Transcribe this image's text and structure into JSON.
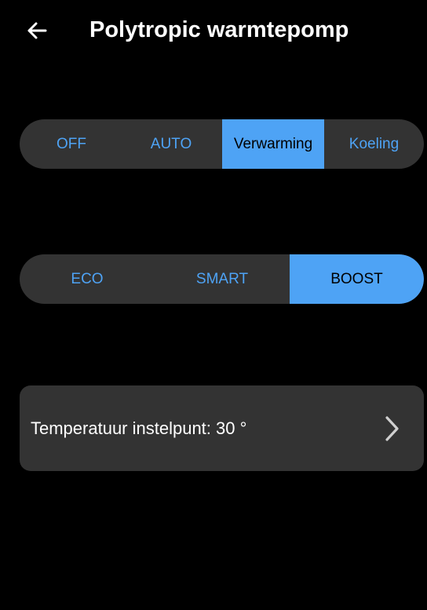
{
  "header": {
    "back_icon": "arrow-left-icon",
    "title": "Polytropic warmtepomp"
  },
  "mode_selector": {
    "options": [
      "OFF",
      "AUTO",
      "Verwarming",
      "Koeling"
    ],
    "selected": "Verwarming"
  },
  "preset_selector": {
    "options": [
      "ECO",
      "SMART",
      "BOOST"
    ],
    "selected": "BOOST"
  },
  "setpoint": {
    "label": "Temperatuur instelpunt: 30 °",
    "chevron_icon": "chevron-right-icon"
  },
  "colors": {
    "background": "#000000",
    "surface": "#333333",
    "accent": "#4ea3f5",
    "text": "#ffffff"
  }
}
